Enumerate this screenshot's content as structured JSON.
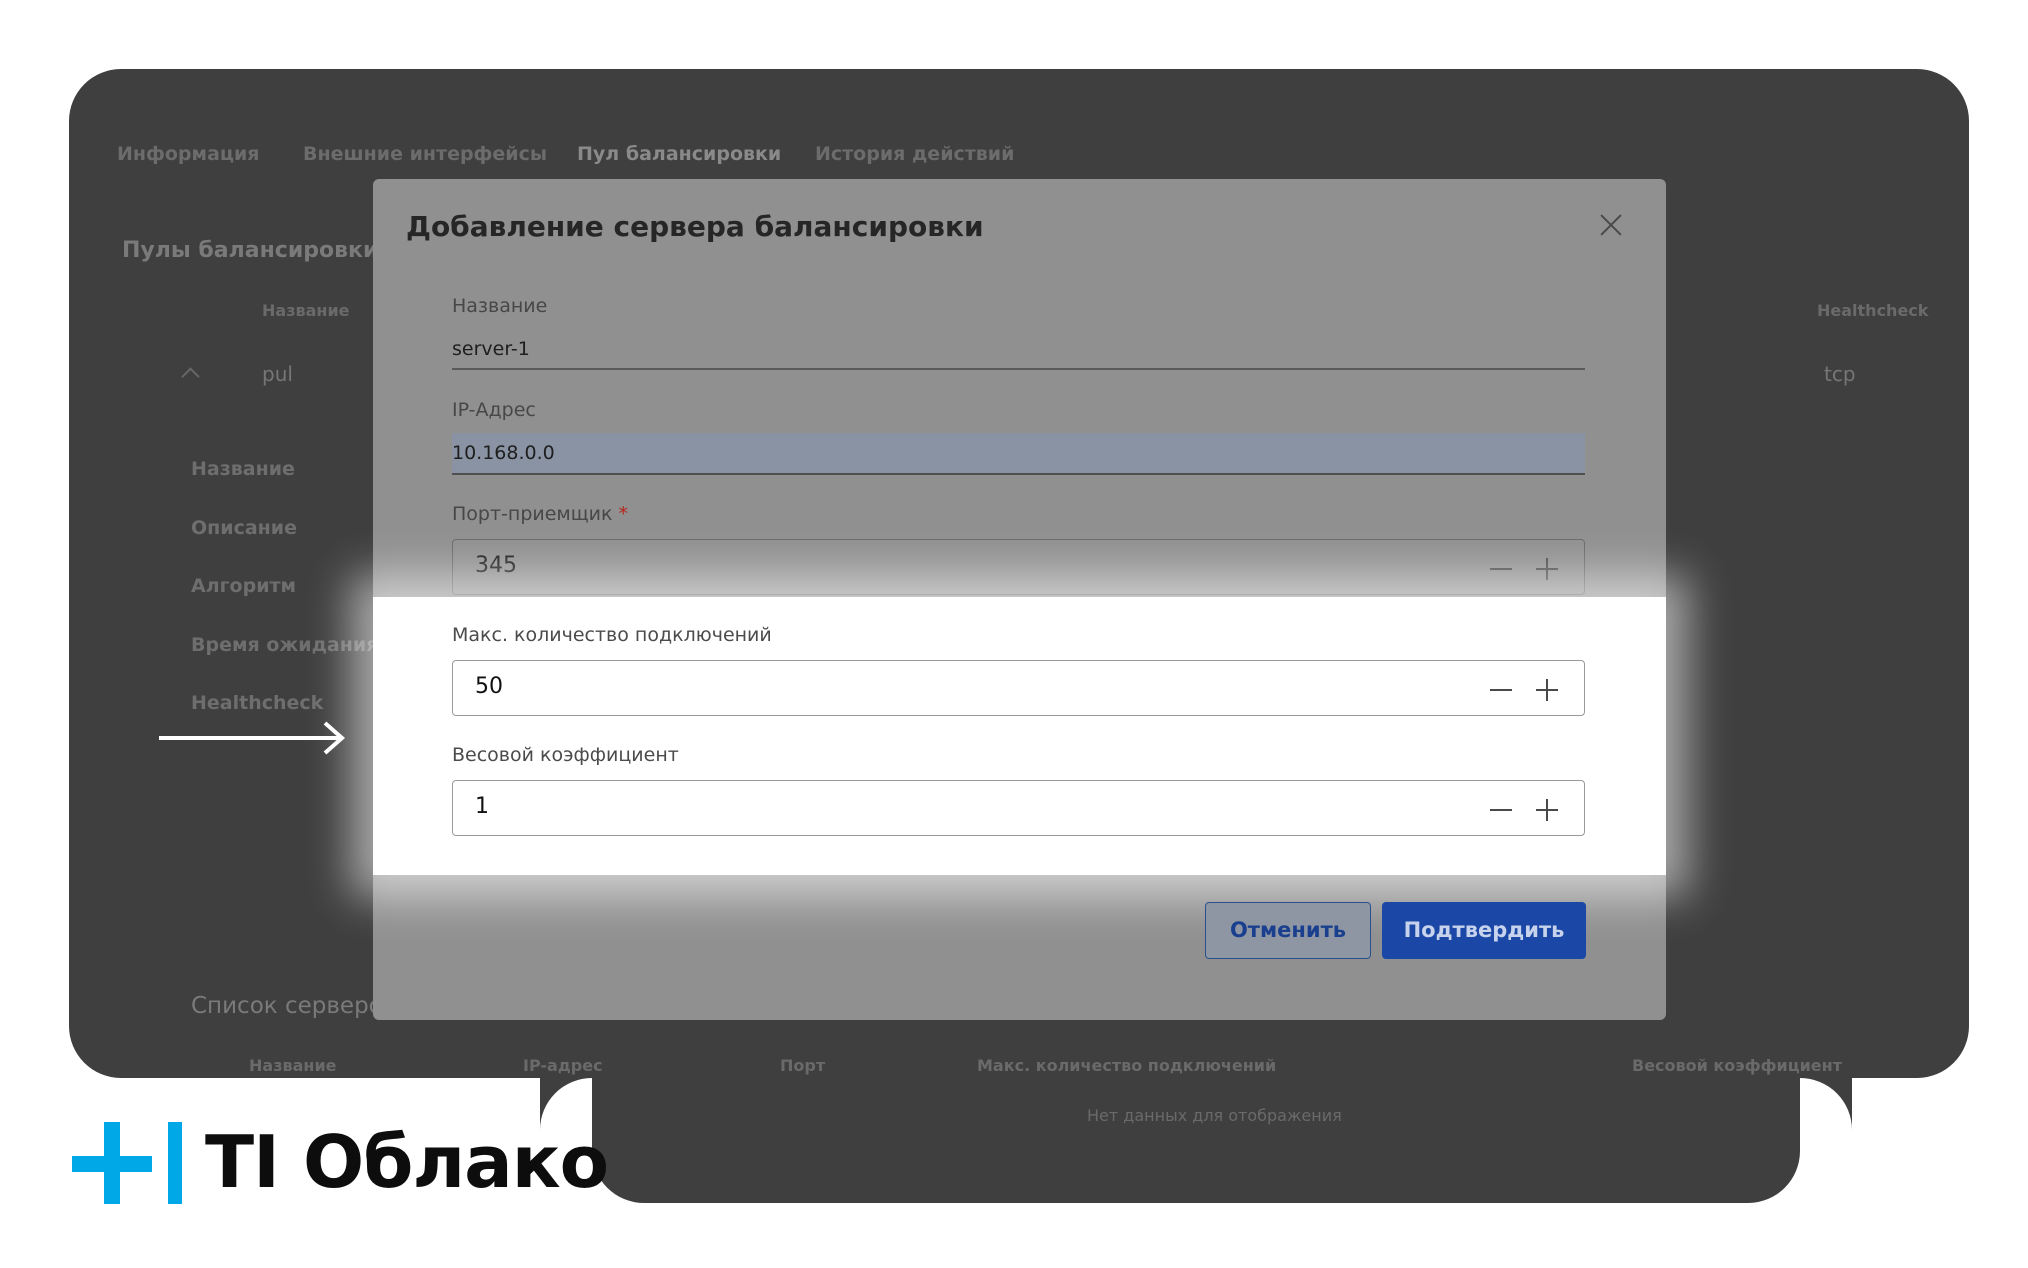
{
  "background": {
    "tabs": [
      "Информация",
      "Внешние интерфейсы",
      "Пул балансировки",
      "История действий"
    ],
    "pools_title": "Пулы балансировки",
    "col_name": "Название",
    "col_healthcheck": "Healthcheck",
    "pool_name": "pul",
    "pool_healthcheck": "tcp",
    "props": [
      "Название",
      "Описание",
      "Алгоритм",
      "Время ожидания (",
      "Healthcheck"
    ],
    "servers_title": "Список серверов",
    "server_cols": [
      "Название",
      "IP-адрес",
      "Порт",
      "Макс. количество подключений",
      "Весовой коэффициент"
    ],
    "empty": "Нет данных для отображения"
  },
  "modal": {
    "title": "Добавление сервера балансировки",
    "name_label": "Название",
    "name_value": "server-1",
    "ip_label": "IP-Адрес",
    "ip_value": "10.168.0.0",
    "port_label": "Порт-приемщик",
    "port_required": "*",
    "port_value": "345",
    "max_conn_label": "Макс. количество подключений",
    "max_conn_value": "50",
    "weight_label": "Весовой коэффициент",
    "weight_value": "1",
    "cancel_label": "Отменить",
    "confirm_label": "Подтвердить"
  },
  "logo": {
    "text": "TI Облако",
    "color": "#00a8e8"
  }
}
